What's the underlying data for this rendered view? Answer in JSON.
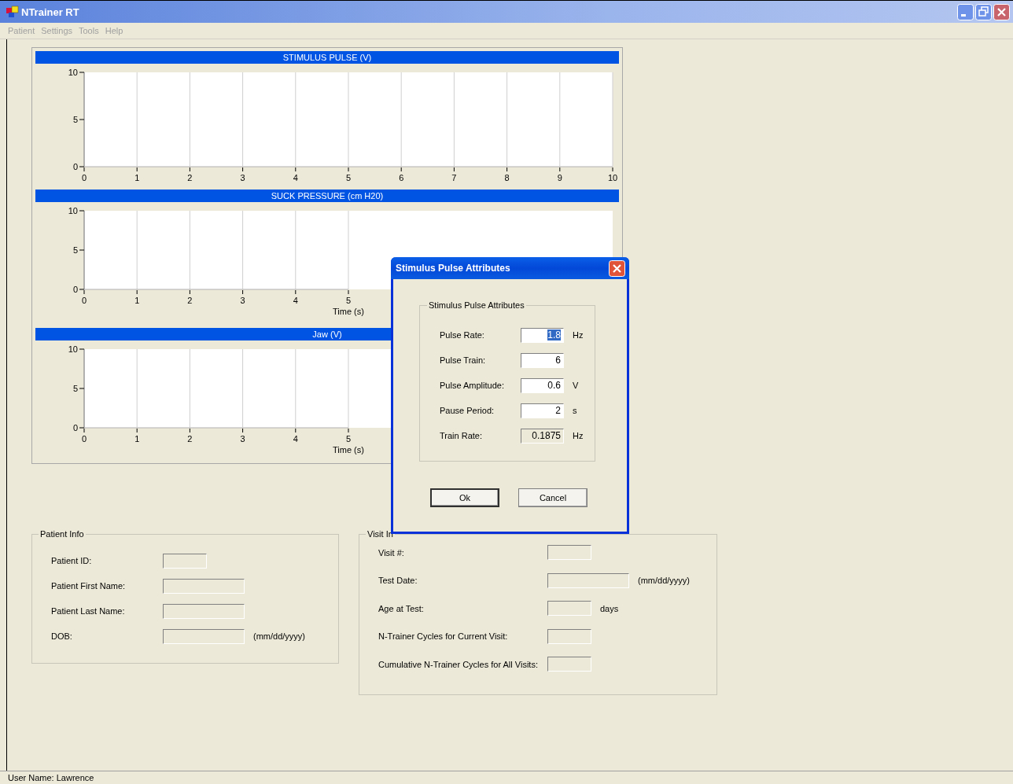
{
  "window": {
    "title": "NTrainer RT"
  },
  "menu": [
    "Patient",
    "Settings",
    "Tools",
    "Help"
  ],
  "charts": [
    {
      "chart_data": {
        "type": "line",
        "title": "STIMULUS PULSE (V)",
        "xlim": [
          0,
          10
        ],
        "ylim": [
          0,
          10
        ],
        "xticks": [
          0,
          1,
          2,
          3,
          4,
          5,
          6,
          7,
          8,
          9,
          10
        ],
        "yticks": [
          0,
          5,
          10
        ],
        "grid": true
      }
    },
    {
      "chart_data": {
        "type": "line",
        "title": "SUCK PRESSURE (cm H20)",
        "xlabel": "Time (s)",
        "xlim": [
          0,
          10
        ],
        "ylim": [
          0,
          10
        ],
        "xticks": [
          0,
          1,
          2,
          3,
          4,
          5
        ],
        "yticks": [
          0,
          5,
          10
        ],
        "grid": true
      }
    },
    {
      "chart_data": {
        "type": "line",
        "title": "Jaw (V)",
        "xlabel": "Time (s)",
        "xlim": [
          0,
          10
        ],
        "ylim": [
          0,
          10
        ],
        "xticks": [
          0,
          1,
          2,
          3,
          4,
          5
        ],
        "yticks": [
          0,
          5,
          10
        ],
        "grid": true
      }
    }
  ],
  "patient_info": {
    "title": "Patient Info",
    "fields": [
      {
        "label": "Patient ID:",
        "kind": "short",
        "disabled": true
      },
      {
        "label": "Patient First Name:",
        "kind": "long",
        "disabled": true
      },
      {
        "label": "Patient Last Name:",
        "kind": "long",
        "disabled": true
      },
      {
        "label": "DOB:",
        "kind": "long",
        "disabled": true,
        "unit": "(mm/dd/yyyy)"
      }
    ]
  },
  "visit_info": {
    "title": "Visit In",
    "fields": [
      {
        "label": "Visit #:",
        "kind": "short",
        "disabled": true
      },
      {
        "label": "Test Date:",
        "kind": "long",
        "disabled": true,
        "unit": "(mm/dd/yyyy)"
      },
      {
        "label": "Age at Test:",
        "kind": "short",
        "disabled": true,
        "unit": "days"
      },
      {
        "label": "N-Trainer Cycles for Current Visit:",
        "kind": "short",
        "disabled": true
      },
      {
        "label": "Cumulative N-Trainer Cycles for All Visits:",
        "kind": "short",
        "disabled": true
      }
    ]
  },
  "dialog": {
    "title": "Stimulus Pulse Attributes",
    "group_title": "Stimulus Pulse Attributes",
    "fields": [
      {
        "label": "Pulse Rate:",
        "value": "1.8",
        "unit": "Hz",
        "highlighted": true,
        "disabled": false
      },
      {
        "label": "Pulse Train:",
        "value": "6",
        "highlighted": false,
        "disabled": false
      },
      {
        "label": "Pulse Amplitude:",
        "value": "0.6",
        "unit": "V",
        "highlighted": false,
        "disabled": false
      },
      {
        "label": "Pause Period:",
        "value": "2",
        "unit": "s",
        "highlighted": false,
        "disabled": false
      },
      {
        "label": "Train Rate:",
        "value": "0.1875",
        "unit": "Hz",
        "highlighted": false,
        "disabled": true
      }
    ],
    "buttons": [
      {
        "label": "Ok",
        "default": true
      },
      {
        "label": "Cancel",
        "default": false
      }
    ]
  },
  "status_bar": "User Name: Lawrence"
}
